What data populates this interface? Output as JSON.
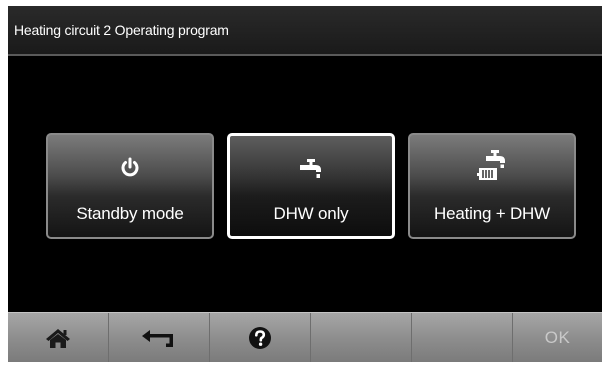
{
  "header": {
    "title": "Heating circuit 2 Operating program"
  },
  "options": [
    {
      "label": "Standby mode",
      "icon": "power-icon",
      "selected": false
    },
    {
      "label": "DHW only",
      "icon": "tap-icon",
      "selected": true
    },
    {
      "label": "Heating + DHW",
      "icon": "radiator-tap-icon",
      "selected": false
    }
  ],
  "navbar": {
    "home_icon": "home-icon",
    "back_icon": "back-arrow-icon",
    "help_icon": "help-icon",
    "ok_label": "OK"
  }
}
